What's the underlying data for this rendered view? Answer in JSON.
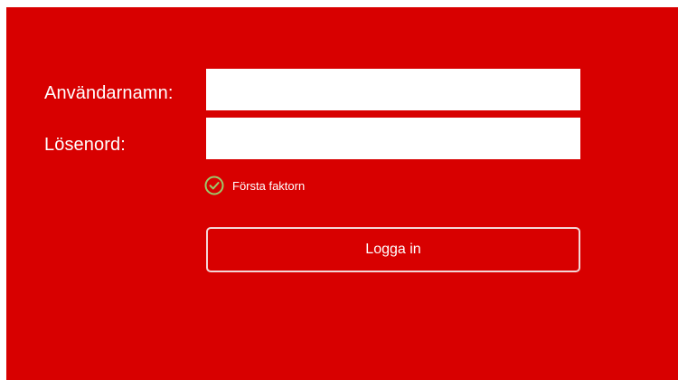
{
  "form": {
    "username_label": "Användarnamn:",
    "username_value": "",
    "password_label": "Lösenord:",
    "password_value": "",
    "first_factor": {
      "label": "Första faktorn",
      "icon": "check-circle-icon",
      "status": "complete"
    },
    "login_button_label": "Logga in"
  },
  "colors": {
    "background": "#d80000",
    "check_icon": "#9bc96a",
    "button_border": "#f3d6d6",
    "text": "#ffffff"
  }
}
